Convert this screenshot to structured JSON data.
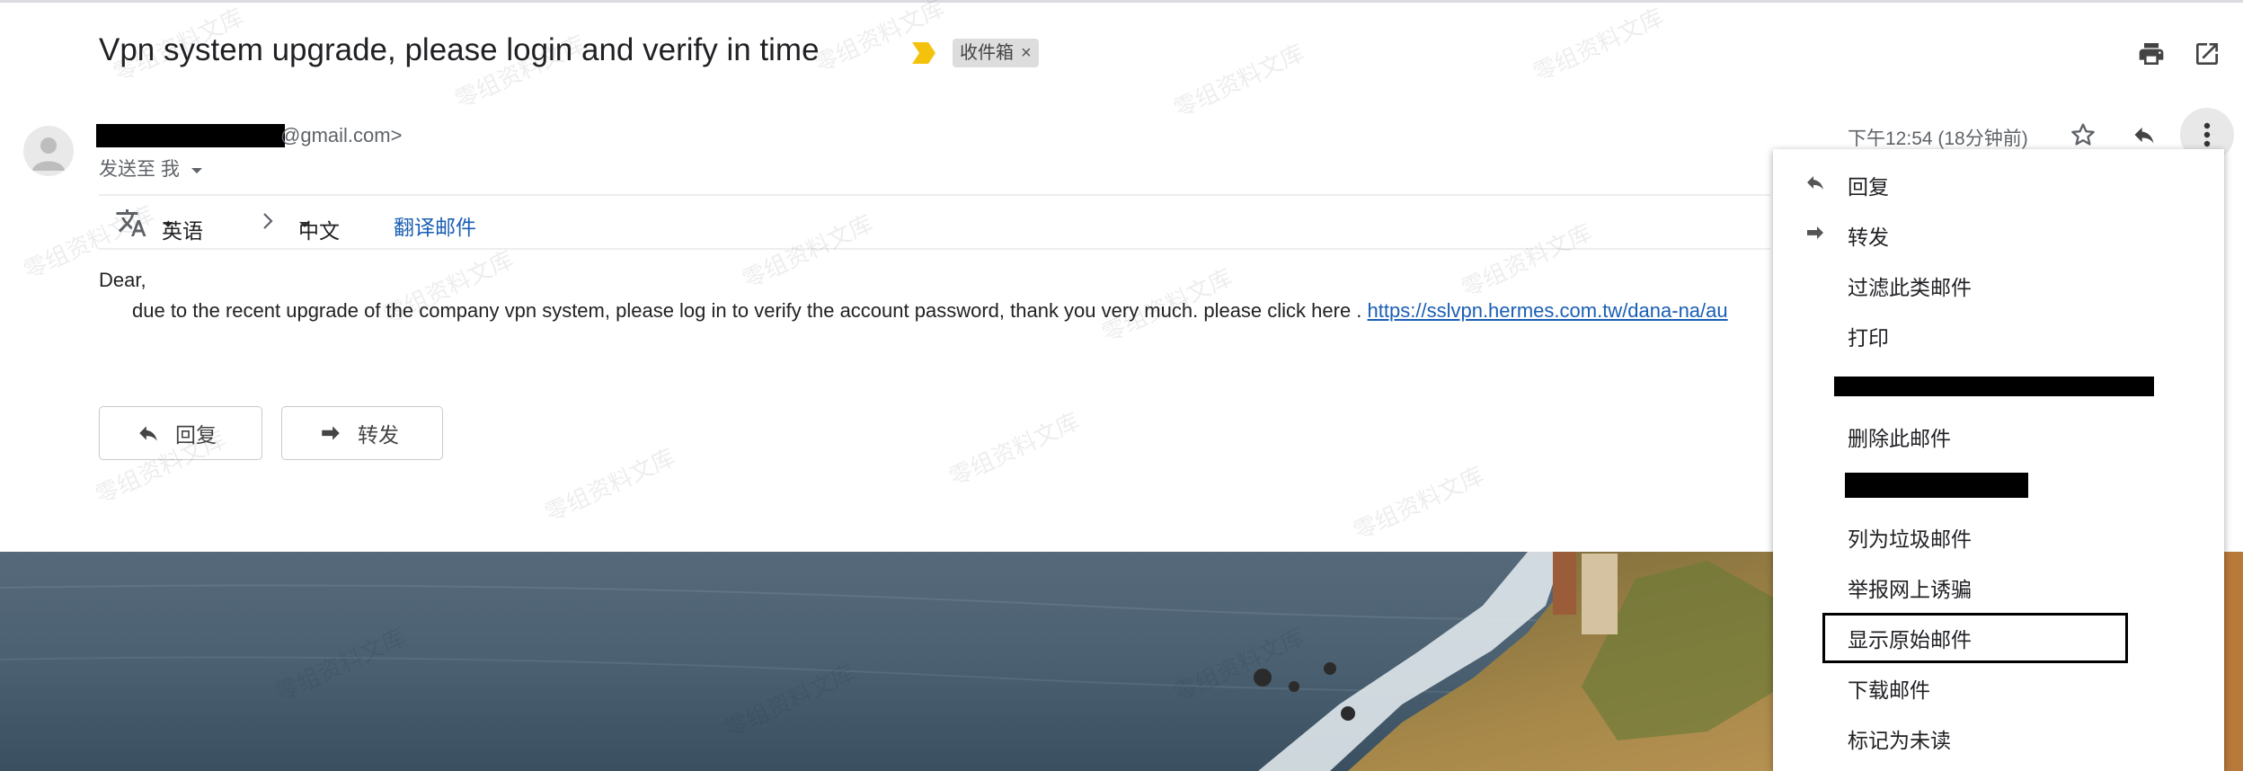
{
  "email": {
    "subject": "Vpn system upgrade, please login and verify in time",
    "label_chip": "收件箱",
    "label_close": "×",
    "sender_email": "@gmail.com>",
    "send_to": "发送至 我",
    "time": "下午12:54 (18分钟前)",
    "translate": {
      "from_lang": "英语",
      "to_lang": "中文",
      "action": "翻译邮件"
    },
    "body_greeting": "Dear,",
    "body_text": "due to the recent upgrade of the company vpn system, please log in to verify the account password, thank you very much. please click here .",
    "body_link": "https://sslvpn.hermes.com.tw/dana-na/au",
    "reply_button": "回复",
    "forward_button": "转发"
  },
  "menu": {
    "items": [
      {
        "label": "回复",
        "icon": "reply-icon"
      },
      {
        "label": "转发",
        "icon": "forward-icon"
      },
      {
        "label": "过滤此类邮件",
        "icon": ""
      },
      {
        "label": "打印",
        "icon": ""
      },
      {
        "label": "",
        "icon": "",
        "redacted": true
      },
      {
        "label": "删除此邮件",
        "icon": ""
      },
      {
        "label": "",
        "icon": "",
        "redacted": true
      },
      {
        "label": "列为垃圾邮件",
        "icon": ""
      },
      {
        "label": "举报网上诱骗",
        "icon": ""
      },
      {
        "label": "显示原始邮件",
        "icon": "",
        "highlighted": true
      },
      {
        "label": "下载邮件",
        "icon": ""
      },
      {
        "label": "标记为未读",
        "icon": ""
      }
    ]
  },
  "watermark_text": "零组资料文库",
  "colors": {
    "link": "#1a5fb4",
    "importance_marker": "#f4c20d",
    "label_chip_bg": "#dddddd"
  }
}
